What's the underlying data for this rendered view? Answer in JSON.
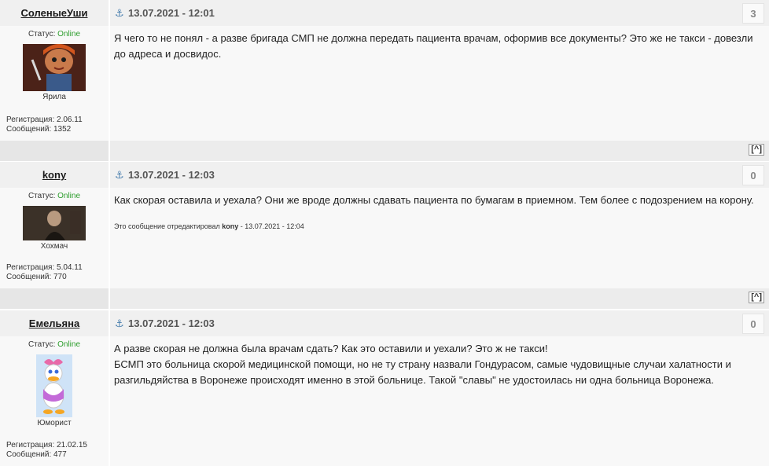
{
  "posts": [
    {
      "author": "СоленыеУши",
      "datetime": "13.07.2021 - 12:01",
      "number": "3",
      "status_label": "Статус:",
      "status_value": "Online",
      "rank": "Ярила",
      "reg": "Регистрация: 2.06.11",
      "messages": "Сообщений: 1352",
      "text": "Я чего то не понял - а разве бригада СМП не должна передать пациента врачам, оформив все документы? Это же не такси - довезли до адреса и досвидос.",
      "edit_prefix": "",
      "edit_user": "",
      "edit_suffix": "",
      "top_label": "[^]"
    },
    {
      "author": "kony",
      "datetime": "13.07.2021 - 12:03",
      "number": "0",
      "status_label": "Статус:",
      "status_value": "Online",
      "rank": "Хохмач",
      "reg": "Регистрация: 5.04.11",
      "messages": "Сообщений: 770",
      "text": "Как скорая оставила и уехала? Они же вроде должны сдавать пациента по бумагам в приемном. Тем более с подозрением на корону.",
      "edit_prefix": "Это сообщение отредактировал ",
      "edit_user": "kony",
      "edit_suffix": " - 13.07.2021 - 12:04",
      "top_label": "[^]"
    },
    {
      "author": "Емельяна",
      "datetime": "13.07.2021 - 12:03",
      "number": "0",
      "status_label": "Статус:",
      "status_value": "Online",
      "rank": "Юморист",
      "reg": "Регистрация: 21.02.15",
      "messages": "Сообщений: 477",
      "text": "А разве скорая не должна была врачам сдать? Как это оставили и уехали? Это ж не такси!",
      "text2": "БСМП это больница скорой медицинской помощи, но не ту страну назвали Гондурасом, самые чудовищные случаи халатности и разгильдяйства в Воронеже происходят именно в этой больнице. Такой \"славы\" не удостоилась ни одна больница Воронежа.",
      "edit_prefix": "",
      "edit_user": "",
      "edit_suffix": "",
      "top_label": ""
    }
  ],
  "icons": {
    "anchor": "anchor-icon",
    "avatar1": "doll-avatar",
    "avatar2": "dark-photo-avatar",
    "avatar3": "daisy-duck-avatar"
  },
  "colors": {
    "online": "#2e9e2e",
    "anchor": "#4a7fae"
  }
}
